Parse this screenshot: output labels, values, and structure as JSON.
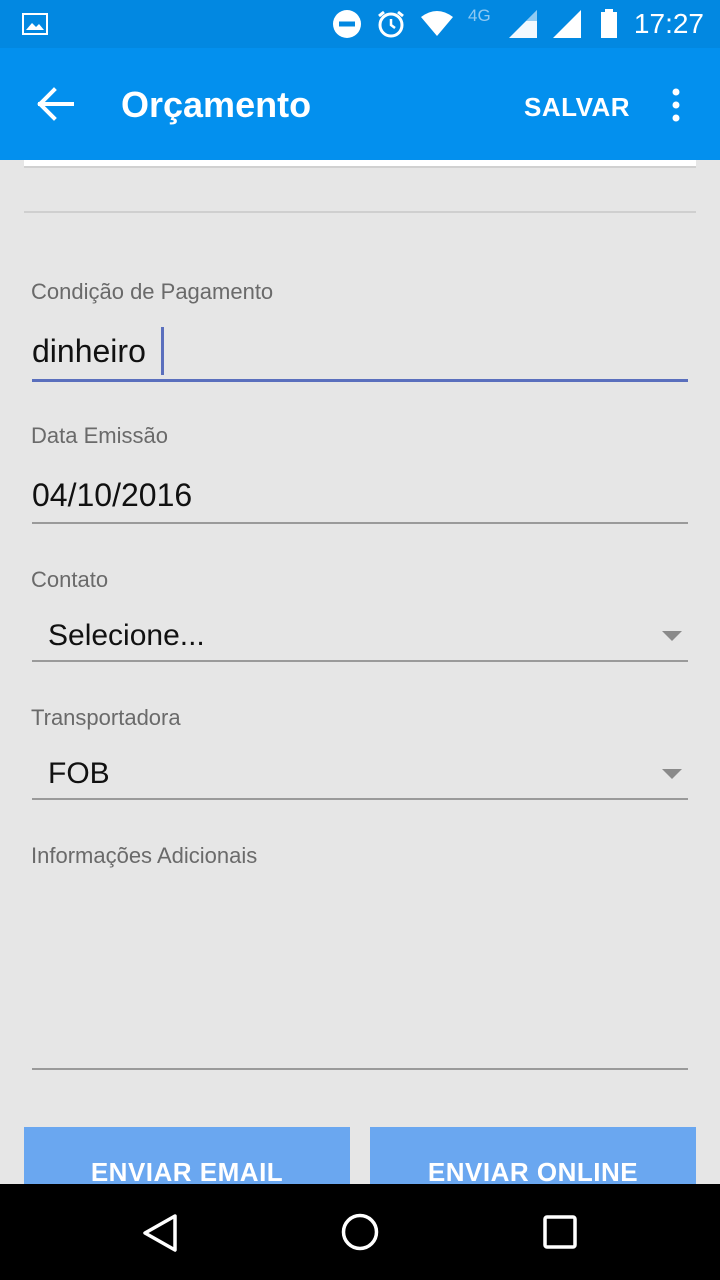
{
  "status_bar": {
    "time": "17:27",
    "network": "4G",
    "icons": [
      "image-icon",
      "do-not-disturb-icon",
      "alarm-icon",
      "wifi-icon",
      "signal-icon",
      "signal-icon",
      "battery-icon"
    ]
  },
  "app_bar": {
    "title": "Orçamento",
    "save_label": "SALVAR"
  },
  "form": {
    "payment_condition": {
      "label": "Condição de Pagamento",
      "value": "dinheiro"
    },
    "issue_date": {
      "label": "Data Emissão",
      "value": "04/10/2016"
    },
    "contact": {
      "label": "Contato",
      "value": "Selecione..."
    },
    "carrier": {
      "label": "Transportadora",
      "value": "FOB"
    },
    "additional_info": {
      "label": "Informações Adicionais",
      "value": ""
    }
  },
  "actions": {
    "send_email": "ENVIAR EMAIL",
    "send_online": "ENVIAR ONLINE"
  },
  "colors": {
    "app_bar": "#0390ee",
    "status_bar": "#0288e1",
    "accent": "#5a6fbd",
    "button": "#6aa7f0",
    "background": "#e6e6e6"
  }
}
